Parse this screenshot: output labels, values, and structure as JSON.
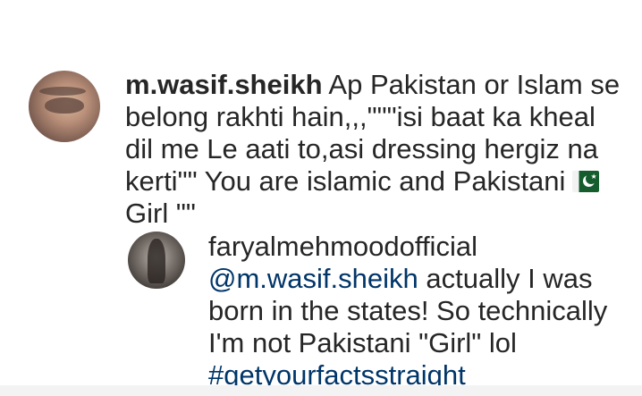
{
  "comment": {
    "username": "m.wasif.sheikh",
    "line1_rest": " Ap Pakistan or Islam se",
    "line2": "belong rakhti hain,,,\"\"\"isi baat ka kheal",
    "line3": "dil me Le aati to,asi dressing hergiz na",
    "line4": "kerti\"\" You are islamic and Pakistani",
    "line5": "Girl \"\"",
    "flag_icon": "pakistan-flag-icon"
  },
  "reply": {
    "username": "faryalmehmoodofficial",
    "mention": "@m.wasif.sheikh",
    "line1_rest": " actually I was",
    "line2": "born in the states! So technically",
    "line3": "I'm not Pakistani \"Girl\" lol",
    "hashtag": "#getyourfactsstraight"
  },
  "colors": {
    "text": "#262626",
    "link": "#003569"
  }
}
